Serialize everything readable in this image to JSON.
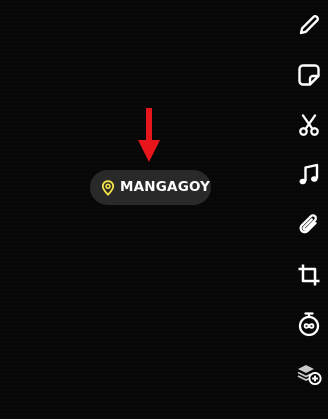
{
  "location_sticker": {
    "label": "MANGAGOY",
    "pin_color": "#f4e34a"
  },
  "annotation_arrow": {
    "color": "#e8151b"
  },
  "toolbar": {
    "tools": [
      {
        "icon": "pencil-icon"
      },
      {
        "icon": "sticker-icon"
      },
      {
        "icon": "scissors-icon"
      },
      {
        "icon": "music-note-icon"
      },
      {
        "icon": "paperclip-icon"
      },
      {
        "icon": "crop-icon"
      },
      {
        "icon": "timer-infinity-icon"
      },
      {
        "icon": "layers-add-icon"
      }
    ]
  },
  "colors": {
    "background": "#070707",
    "icon": "#ffffff",
    "pill": "#2d2d2d"
  }
}
